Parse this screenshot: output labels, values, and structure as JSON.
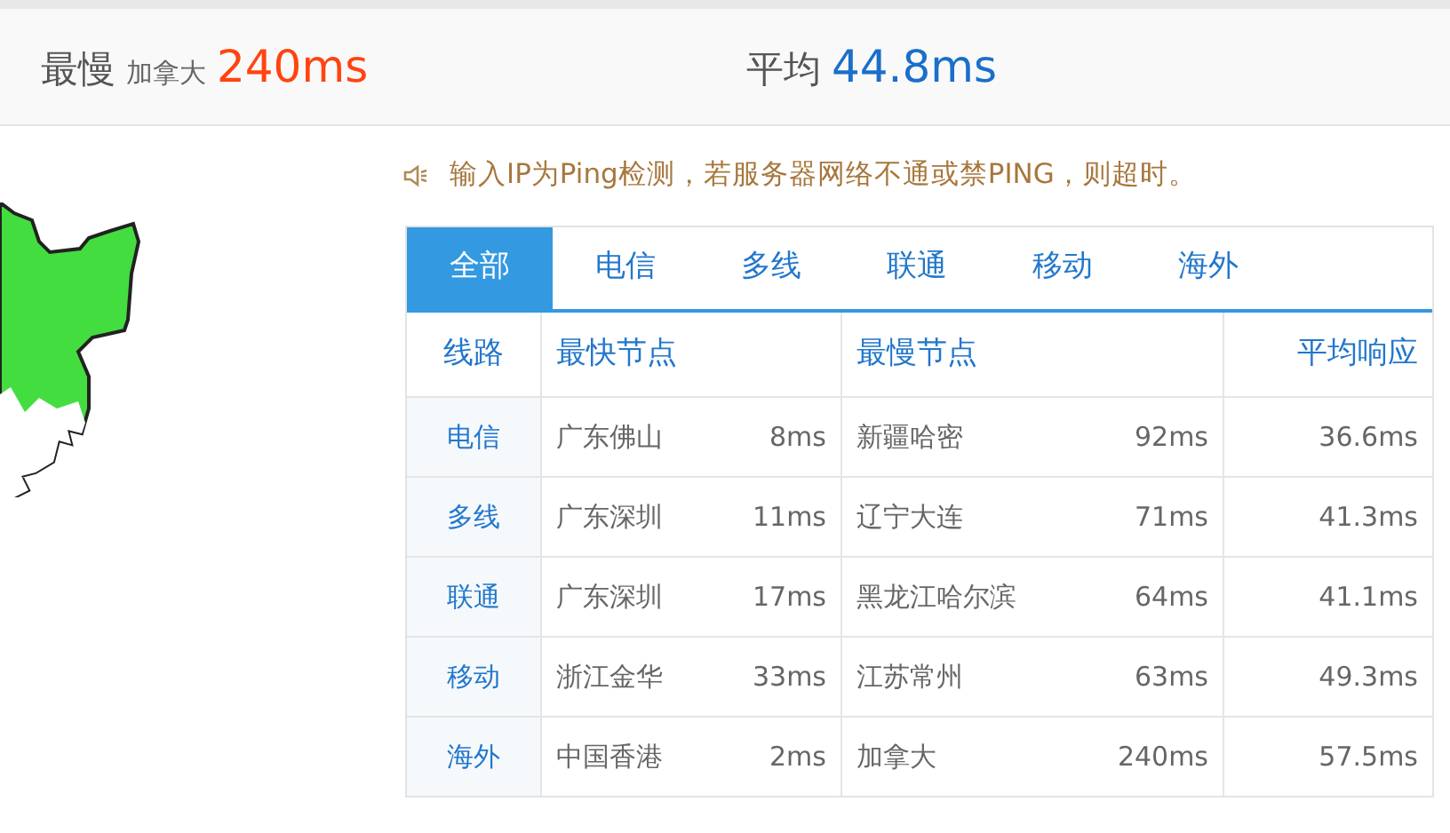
{
  "stats": {
    "slowest": {
      "label": "最慢",
      "place": "加拿大",
      "value": "240ms"
    },
    "average": {
      "label": "平均",
      "value": "44.8ms"
    }
  },
  "notice": "输入IP为Ping检测，若服务器网络不通或禁PING，则超时。",
  "tabs": [
    {
      "label": "全部",
      "selected": true
    },
    {
      "label": "电信",
      "selected": false
    },
    {
      "label": "多线",
      "selected": false
    },
    {
      "label": "联通",
      "selected": false
    },
    {
      "label": "移动",
      "selected": false
    },
    {
      "label": "海外",
      "selected": false
    }
  ],
  "table": {
    "columns": [
      "线路",
      "最快节点",
      "最慢节点",
      "平均响应"
    ],
    "rows": [
      {
        "line": "电信",
        "fastest_node": "广东佛山",
        "fastest_time": "8ms",
        "slowest_node": "新疆哈密",
        "slowest_time": "92ms",
        "average": "36.6ms"
      },
      {
        "line": "多线",
        "fastest_node": "广东深圳",
        "fastest_time": "11ms",
        "slowest_node": "辽宁大连",
        "slowest_time": "71ms",
        "average": "41.3ms"
      },
      {
        "line": "联通",
        "fastest_node": "广东深圳",
        "fastest_time": "17ms",
        "slowest_node": "黑龙江哈尔滨",
        "slowest_time": "64ms",
        "average": "41.1ms"
      },
      {
        "line": "移动",
        "fastest_node": "浙江金华",
        "fastest_time": "33ms",
        "slowest_node": "江苏常州",
        "slowest_time": "63ms",
        "average": "49.3ms"
      },
      {
        "line": "海外",
        "fastest_node": "中国香港",
        "fastest_time": "2ms",
        "slowest_node": "加拿大",
        "slowest_time": "240ms",
        "average": "57.5ms"
      }
    ]
  }
}
